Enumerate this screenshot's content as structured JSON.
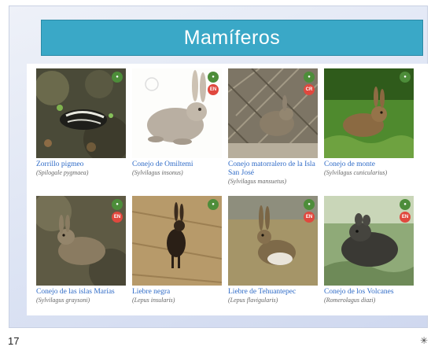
{
  "slide": {
    "title": "Mamíferos",
    "page_number": "17",
    "footer_icon": "pin-icon"
  },
  "animals": [
    {
      "name": "Zorrillo pigmeo",
      "sci": "(Spilogale pygmaea)",
      "status": ""
    },
    {
      "name": "Conejo de Omiltemi",
      "sci": "(Sylvilagus insonus)",
      "status": "EN"
    },
    {
      "name": "Conejo matorralero de la Isla San José",
      "sci": "(Sylvilagus mansuetus)",
      "status": "CR"
    },
    {
      "name": "Conejo de monte",
      "sci": "(Sylvilagus cunicularius)",
      "status": ""
    },
    {
      "name": "Conejo de las islas Marías",
      "sci": "(Sylvilagus graysoni)",
      "status": "EN"
    },
    {
      "name": "Liebre negra",
      "sci": "(Lepus insularis)",
      "status": ""
    },
    {
      "name": "Liebre de Tehuantepec",
      "sci": "(Lepus flavigularis)",
      "status": "EN"
    },
    {
      "name": "Conejo de los Volcanes",
      "sci": "(Romerolagus diazi)",
      "status": "EN"
    }
  ],
  "colors": {
    "title_bar": "#3aa8c7",
    "caption_link": "#2f6bc7",
    "status_red": "#e0483e",
    "status_green": "#4d8d3a"
  }
}
